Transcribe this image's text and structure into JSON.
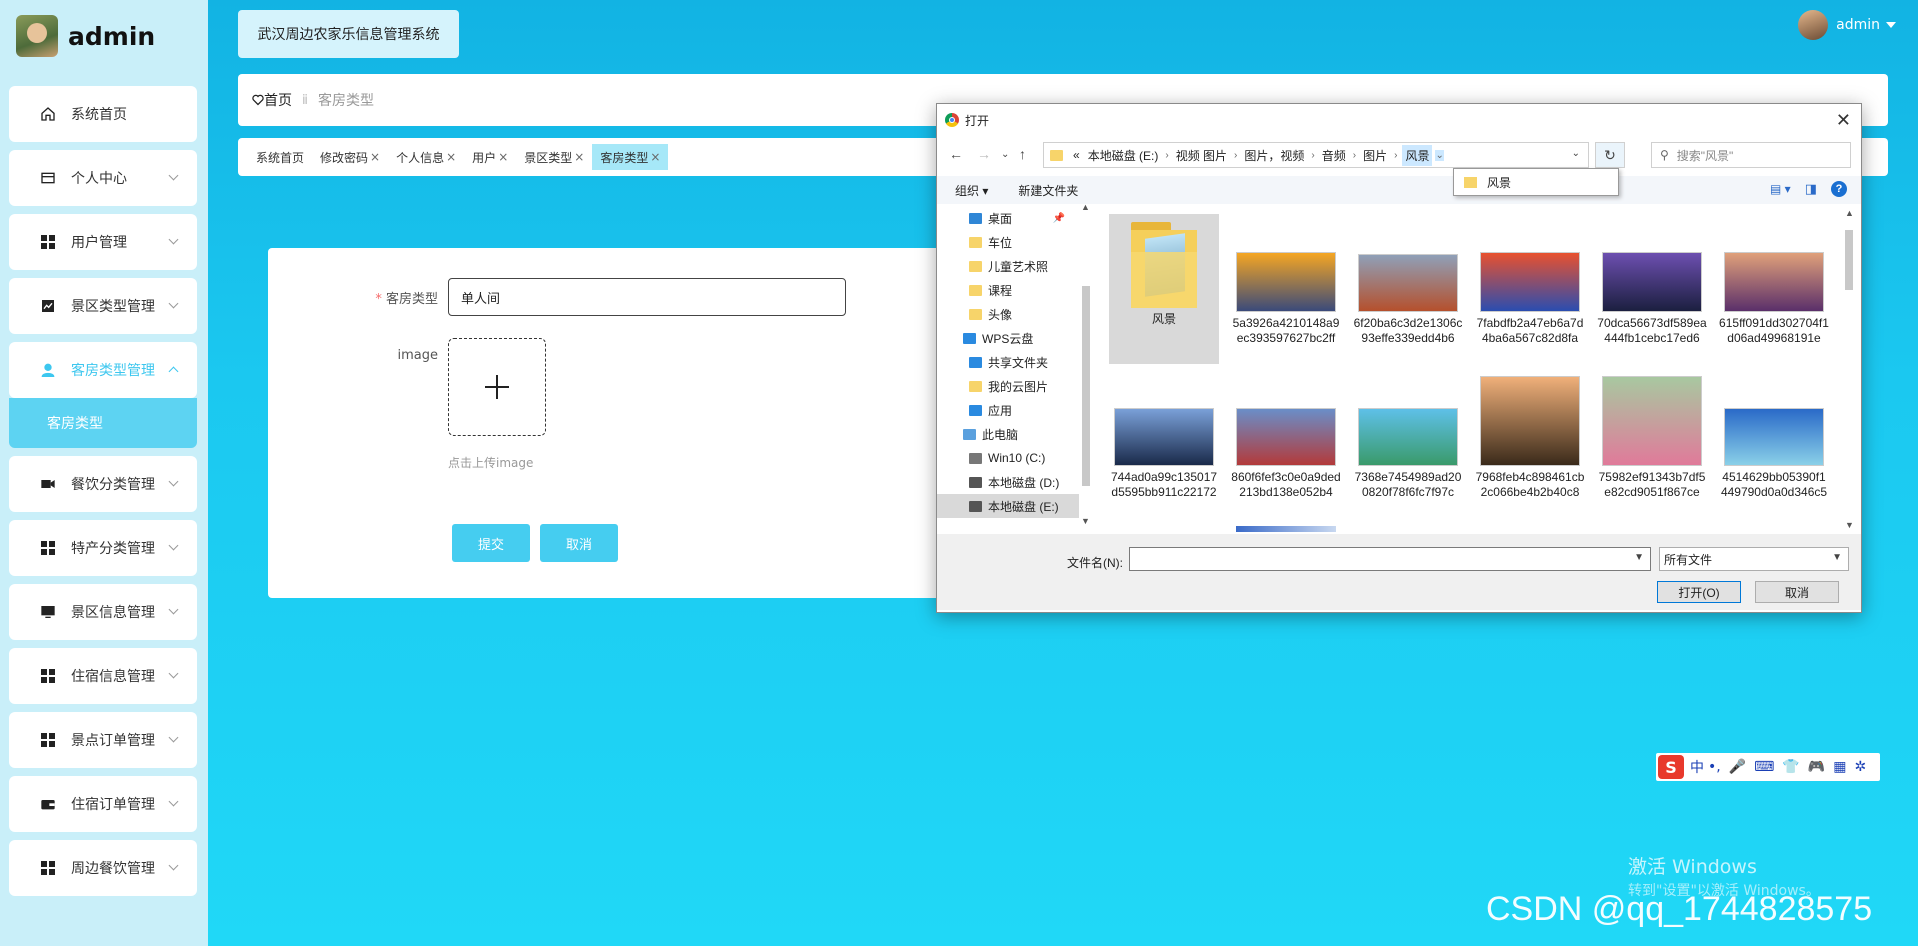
{
  "brand": {
    "name": "admin"
  },
  "sidebar": {
    "items": [
      {
        "label": "系统首页",
        "icon": "home-icon"
      },
      {
        "label": "个人中心",
        "icon": "card-icon"
      },
      {
        "label": "用户管理",
        "icon": "grid-icon"
      },
      {
        "label": "景区类型管理",
        "icon": "chart-icon"
      },
      {
        "label": "客房类型管理",
        "icon": "person-icon"
      },
      {
        "label": "餐饮分类管理",
        "icon": "video-icon"
      },
      {
        "label": "特产分类管理",
        "icon": "grid-icon"
      },
      {
        "label": "景区信息管理",
        "icon": "monitor-icon"
      },
      {
        "label": "住宿信息管理",
        "icon": "grid-icon"
      },
      {
        "label": "景点订单管理",
        "icon": "grid-icon"
      },
      {
        "label": "住宿订单管理",
        "icon": "wallet-icon"
      },
      {
        "label": "周边餐饮管理",
        "icon": "grid-icon"
      }
    ],
    "active_sub": "客房类型"
  },
  "header": {
    "system_title": "武汉周边农家乐信息管理系统",
    "user": "admin"
  },
  "breadcrumb": {
    "home": "首页",
    "current": "客房类型"
  },
  "tabs": [
    {
      "label": "系统首页",
      "closable": false
    },
    {
      "label": "修改密码",
      "closable": true
    },
    {
      "label": "个人信息",
      "closable": true
    },
    {
      "label": "用户",
      "closable": true
    },
    {
      "label": "景区类型",
      "closable": true
    },
    {
      "label": "客房类型",
      "closable": true,
      "active": true
    }
  ],
  "form": {
    "room_type_label": "客房类型",
    "room_type_value": "单人间",
    "image_label": "image",
    "upload_hint": "点击上传image",
    "submit": "提交",
    "cancel": "取消"
  },
  "dialog": {
    "title": "打开",
    "path": [
      "本地磁盘 (E:)",
      "视频 图片",
      "图片，视频",
      "音频",
      "图片",
      "风景"
    ],
    "path_prefix": "«",
    "search_placeholder": "搜索\"风景\"",
    "popup_item": "风景",
    "organize": "组织 ▾",
    "new_folder": "新建文件夹",
    "tree": [
      {
        "label": "桌面",
        "level": 1,
        "pinned": true,
        "color": "#2f86d6"
      },
      {
        "label": "车位",
        "level": 1
      },
      {
        "label": "儿童艺术照",
        "level": 1
      },
      {
        "label": "课程",
        "level": 1
      },
      {
        "label": "头像",
        "level": 1
      },
      {
        "label": "WPS云盘",
        "level": 0,
        "color": "#2a8ae0"
      },
      {
        "label": "共享文件夹",
        "level": 1,
        "color": "#2a8ae0"
      },
      {
        "label": "我的云图片",
        "level": 1
      },
      {
        "label": "应用",
        "level": 1,
        "color": "#2a8ae0"
      },
      {
        "label": "此电脑",
        "level": 0,
        "color": "#5aa0de"
      },
      {
        "label": "Win10 (C:)",
        "level": 1,
        "color": "#777777"
      },
      {
        "label": "本地磁盘 (D:)",
        "level": 1,
        "color": "#555555"
      },
      {
        "label": "本地磁盘 (E:)",
        "level": 1,
        "color": "#555555",
        "selected": true
      }
    ],
    "files": [
      {
        "name": "风景",
        "folder": true
      },
      {
        "name": "5a3926a4210148a9ec393597627bc2ff",
        "c1": "#f5a623",
        "c2": "#3a4a7a"
      },
      {
        "name": "6f20ba6c3d2e1306c93effe339edd4b6",
        "c1": "#8fa0b8",
        "c2": "#b5502c"
      },
      {
        "name": "7fabdfb2a47eb6a7d4ba6a567c82d8fa",
        "c1": "#e8512f",
        "c2": "#2a4db0"
      },
      {
        "name": "70dca56673df589ea444fb1cebc17ed6",
        "c1": "#6d4fb0",
        "c2": "#1b1f3f"
      },
      {
        "name": "615ff091dd302704f1d06ad49968191e",
        "c1": "#e0a07a",
        "c2": "#5a2f6a"
      },
      {
        "name": "744ad0a99c135017d5595bb911c22172",
        "c1": "#7aa0d8",
        "c2": "#1a2a4a"
      },
      {
        "name": "860f6fef3c0e0a9ded213bd138e052b4",
        "c1": "#6a8ec8",
        "c2": "#b33a3a"
      },
      {
        "name": "7368e7454989ad200820f78f6fc7f97c",
        "c1": "#5ec0e8",
        "c2": "#3a9a6a"
      },
      {
        "name": "7968feb4c898461cb2c066be4b2b40c8",
        "c1": "#f0b07a",
        "c2": "#3a2a1a"
      },
      {
        "name": "75982ef91343b7df5e82cd9051f867ce",
        "c1": "#a8c8a0",
        "c2": "#e07a9a"
      },
      {
        "name": "4514629bb05390f1449790d0a0d346c5",
        "c1": "#2a6ac8",
        "c2": "#8ad0e8"
      }
    ],
    "filename_label": "文件名(N):",
    "filename_value": "",
    "filetype": "所有文件",
    "open_button": "打开(O)",
    "cancel_button": "取消"
  },
  "ime": {
    "lang": "中",
    "symbols": [
      "•,",
      "🎤",
      "⌨",
      "👕",
      "🎮",
      "▦",
      "✲"
    ]
  },
  "watermark": {
    "line1": "激活 Windows",
    "line2": "转到\"设置\"以激活 Windows。"
  },
  "csdn": "CSDN @qq_1744828575",
  "colors": {
    "accent": "#45cdf0",
    "active_tab": "#a6e8f8",
    "sidebar_bg": "#c9eff9"
  }
}
